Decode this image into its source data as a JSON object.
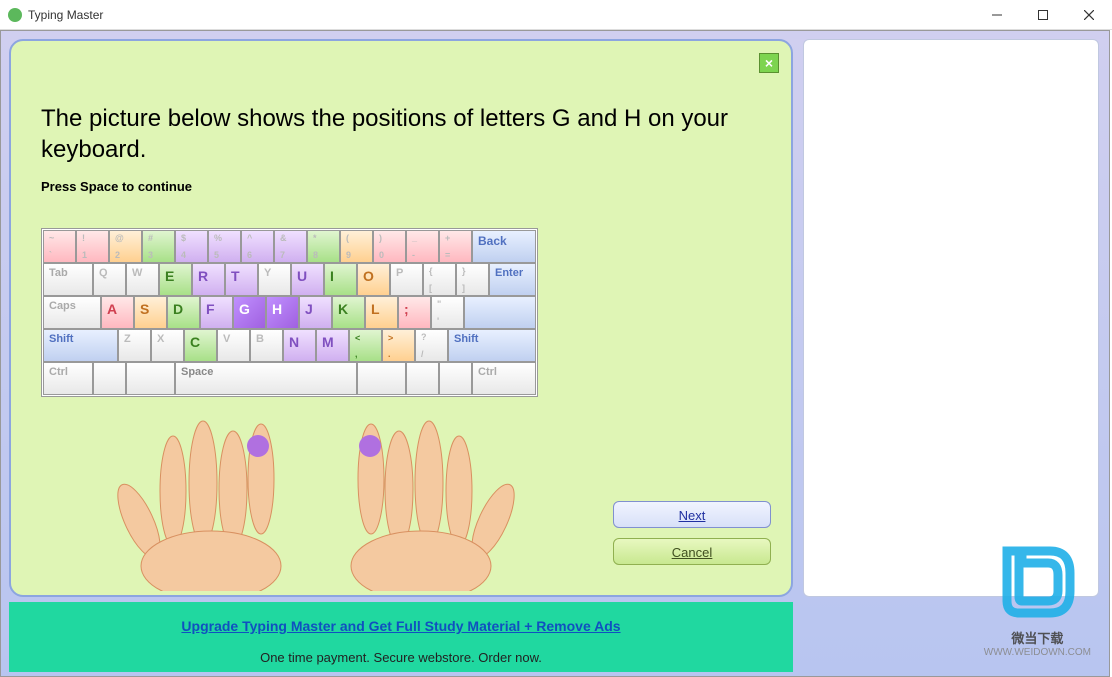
{
  "app": {
    "title": "Typing Master"
  },
  "lesson": {
    "instruction": "The picture below shows the positions of letters G and H on your keyboard.",
    "sub": "Press Space to continue"
  },
  "keyboard": {
    "row1": [
      "~\n`",
      "!\n1",
      "@\n2",
      "#\n3",
      "$\n4",
      "%\n5",
      "^\n6",
      "&\n7",
      "*\n8",
      "(\n9",
      ")\n0",
      "_\n-",
      "+\n="
    ],
    "row1_back": "Back",
    "row2_tab": "Tab",
    "row2": [
      "Q",
      "W",
      "E",
      "R",
      "T",
      "Y",
      "U",
      "I",
      "O",
      "P",
      "{\n[",
      "}\n]"
    ],
    "row2_enter": "Enter",
    "row3_caps": "Caps",
    "row3": [
      "A",
      "S",
      "D",
      "F",
      "G",
      "H",
      "J",
      "K",
      "L",
      ":\n;",
      "\"\n'"
    ],
    "row4_shift_l": "Shift",
    "row4": [
      "Z",
      "X",
      "C",
      "V",
      "B",
      "N",
      "M",
      "<\n,",
      ">\n.",
      "?\n/"
    ],
    "row4_shift_r": "Shift",
    "row5_ctrl_l": "Ctrl",
    "row5_space": "Space",
    "row5_ctrl_r": "Ctrl"
  },
  "buttons": {
    "next": "Next",
    "cancel": "Cancel"
  },
  "upgrade": {
    "link": "Upgrade Typing Master and Get Full Study Material + Remove Ads",
    "sub": "One time payment. Secure webstore. Order now."
  },
  "watermark": {
    "text": "微当下载",
    "url": "WWW.WEIDOWN.COM"
  }
}
